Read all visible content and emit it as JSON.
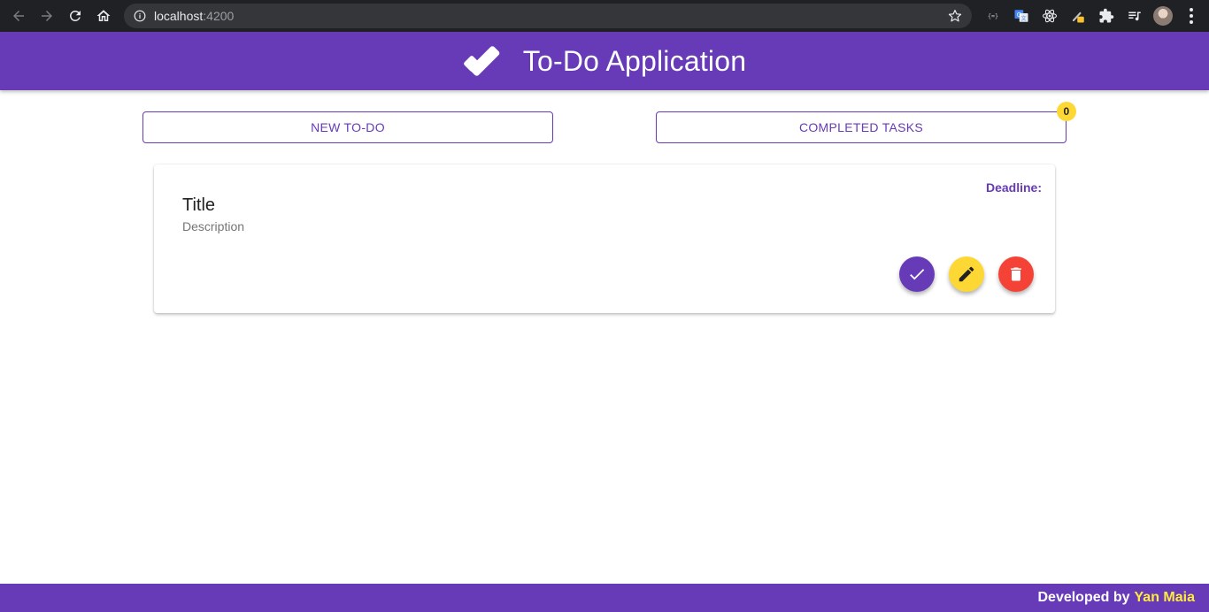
{
  "browser": {
    "url_host": "localhost",
    "url_port": ":4200"
  },
  "header": {
    "title": "To-Do Application"
  },
  "actions": {
    "new_todo_label": "NEW TO-DO",
    "completed_label": "COMPLETED TASKS",
    "completed_count": "0"
  },
  "task": {
    "title": "Title",
    "description": "Description",
    "deadline_label": "Deadline:"
  },
  "footer": {
    "developed_by": "Developed by",
    "author": "Yan Maia"
  },
  "colors": {
    "primary": "#673ab7",
    "accent_yellow": "#fdd835",
    "warn": "#f44336"
  }
}
